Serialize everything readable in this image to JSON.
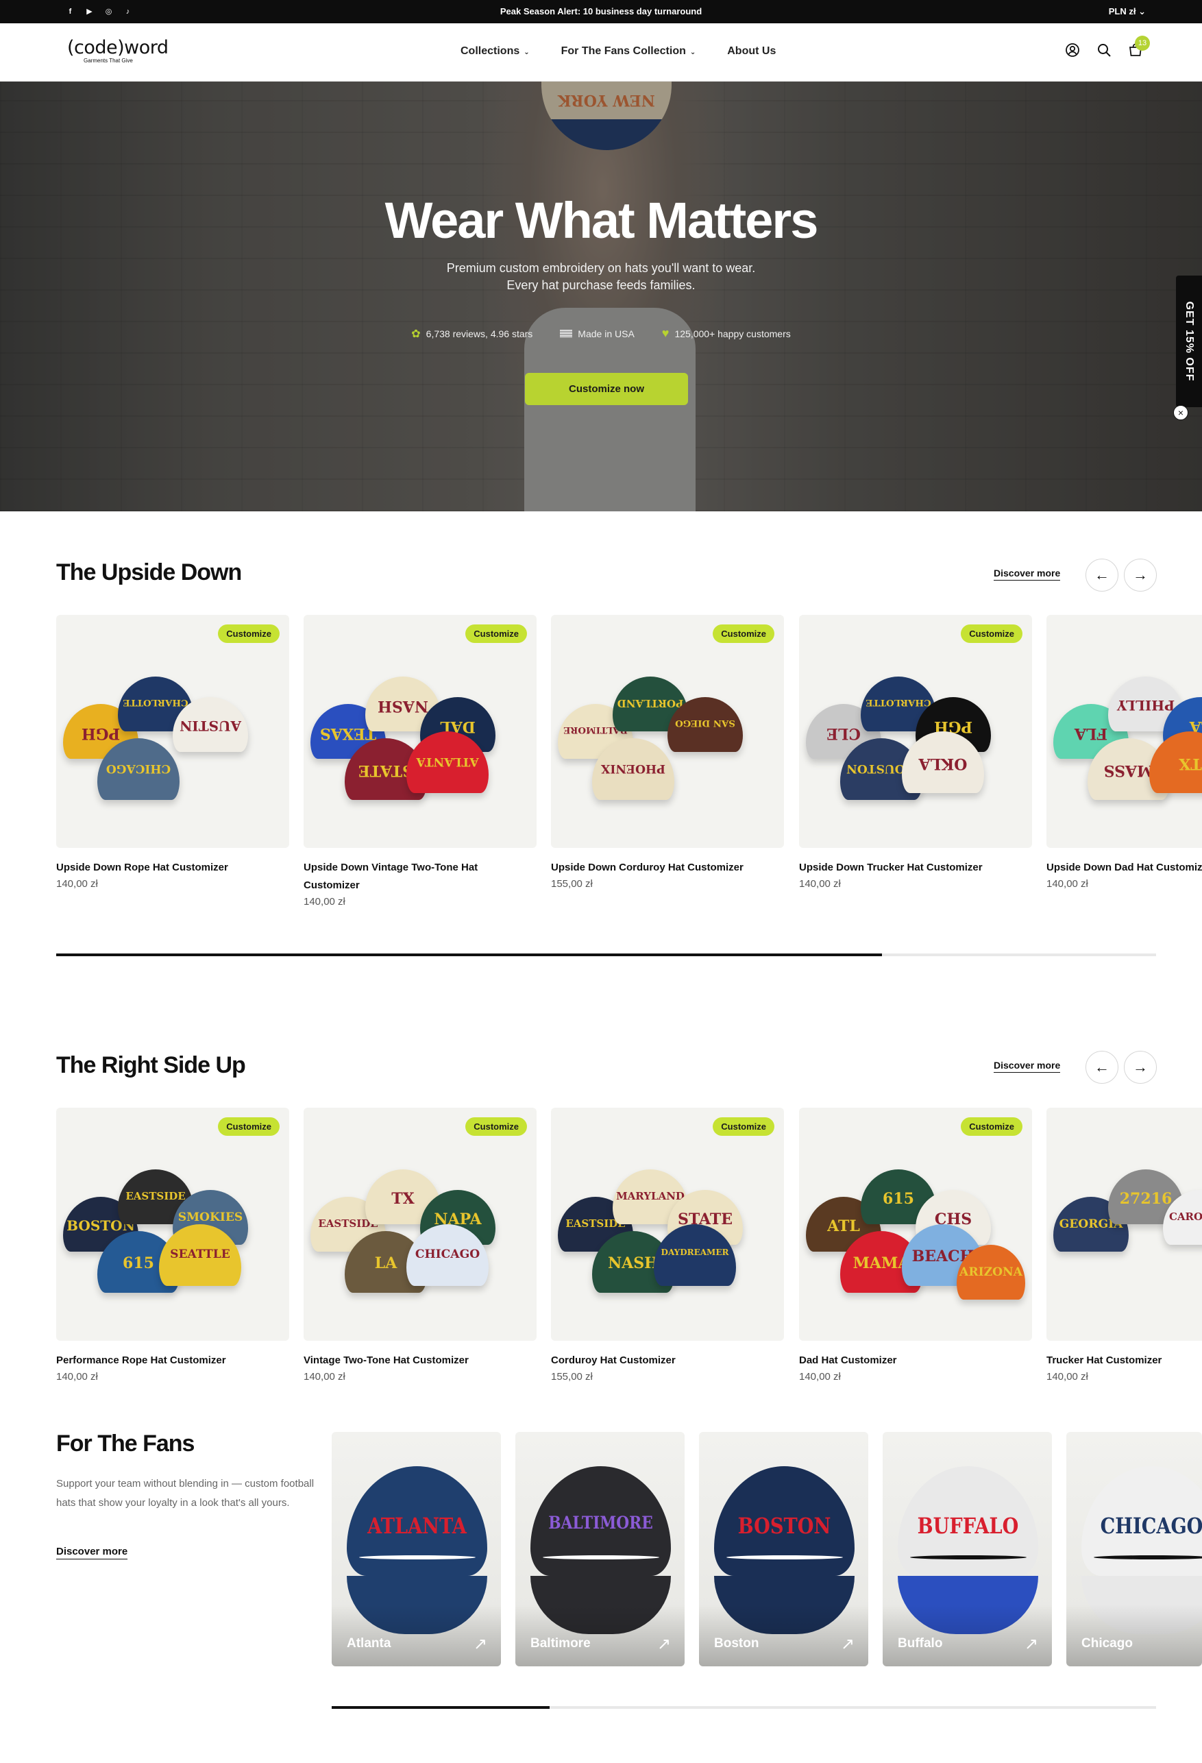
{
  "topbar": {
    "social": [
      "facebook-icon",
      "youtube-icon",
      "instagram-icon",
      "tiktok-icon"
    ],
    "alert": "Peak Season Alert: 10 business day turnaround",
    "currency": "PLN zł ⌄"
  },
  "header": {
    "logo_main": "(code)word",
    "logo_sub": "Garments That Give",
    "nav": [
      {
        "label": "Collections",
        "has_dropdown": true
      },
      {
        "label": "For The Fans Collection",
        "has_dropdown": true
      },
      {
        "label": "About Us",
        "has_dropdown": false
      }
    ],
    "cart_count": "13"
  },
  "hero": {
    "title": "Wear What Matters",
    "subtitle_line1": "Premium custom embroidery on hats you'll want to wear.",
    "subtitle_line2": "Every hat purchase feeds families.",
    "trust": [
      {
        "icon": "stars-icon",
        "text": "6,738 reviews, 4.96 stars"
      },
      {
        "icon": "us-flag-icon",
        "text": "Made in USA"
      },
      {
        "icon": "heart-icon",
        "text": "125,000+ happy customers"
      }
    ],
    "cta": "Customize now",
    "cap_text": "NEW YORK"
  },
  "popup_tab": "GET 15% OFF",
  "sections": [
    {
      "title": "The Upside Down",
      "discover": "Discover more",
      "products": [
        {
          "name": "Upside Down Rope Hat Customizer",
          "price": "140,00 zł",
          "badge": "Customize",
          "hats": [
            [
              "PGH",
              "#e8b020"
            ],
            [
              "CHARLOTTE",
              "#1f3866"
            ],
            [
              "AUSTIN",
              "#f0ede5"
            ],
            [
              "CHICAGO",
              "#4f6b8a"
            ]
          ]
        },
        {
          "name": "Upside Down Vintage Two-Tone Hat Customizer",
          "price": "140,00 zł",
          "badge": "Customize",
          "hats": [
            [
              "TEXAS",
              "#2a4fbf"
            ],
            [
              "NASH",
              "#ede3c4"
            ],
            [
              "DAL",
              "#182b4e"
            ],
            [
              "STATE",
              "#8b2030"
            ],
            [
              "ATLANTA",
              "#d81f2e"
            ]
          ]
        },
        {
          "name": "Upside Down Corduroy Hat Customizer",
          "price": "155,00 zł",
          "badge": "Customize",
          "hats": [
            [
              "BALTIMORE",
              "#ede3c4"
            ],
            [
              "PORTLAND",
              "#24503d"
            ],
            [
              "SAN DIEGO",
              "#5a3024"
            ],
            [
              "PHOENIX",
              "#e9dec0"
            ]
          ]
        },
        {
          "name": "Upside Down Trucker Hat Customizer",
          "price": "140,00 zł",
          "badge": "Customize",
          "hats": [
            [
              "CLE",
              "#c8c8c8"
            ],
            [
              "CHARLOTTE",
              "#1f3866"
            ],
            [
              "PGH",
              "#111111"
            ],
            [
              "HOUSTON",
              "#2b3d63"
            ],
            [
              "OKLA",
              "#efeadf"
            ]
          ]
        },
        {
          "name": "Upside Down Dad Hat Customizer",
          "price": "140,00 zł",
          "badge": "",
          "hats": [
            [
              "FLA",
              "#5fd4b0"
            ],
            [
              "PHILLY",
              "#e6e6e6"
            ],
            [
              "LA",
              "#2459b0"
            ],
            [
              "MASS",
              "#ece4cf"
            ],
            [
              "TX",
              "#e46a22"
            ]
          ]
        }
      ]
    },
    {
      "title": "The Right Side Up",
      "discover": "Discover more",
      "products": [
        {
          "name": "Performance Rope Hat Customizer",
          "price": "140,00 zł",
          "badge": "Customize",
          "hats": [
            [
              "BOSTON",
              "#1f2a44"
            ],
            [
              "EASTSIDE",
              "#2c2c2c"
            ],
            [
              "SMOKIES",
              "#4c6b8a"
            ],
            [
              "615",
              "#255a94"
            ],
            [
              "SEATTLE",
              "#e8c52d"
            ]
          ]
        },
        {
          "name": "Vintage Two-Tone Hat Customizer",
          "price": "140,00 zł",
          "badge": "Customize",
          "hats": [
            [
              "EASTSIDE",
              "#ede3c4"
            ],
            [
              "TX",
              "#ede3c4"
            ],
            [
              "NAPA",
              "#24503d"
            ],
            [
              "LA",
              "#6b5a3e"
            ],
            [
              "CHICAGO",
              "#dfe7f2"
            ]
          ]
        },
        {
          "name": "Corduroy Hat Customizer",
          "price": "155,00 zł",
          "badge": "Customize",
          "hats": [
            [
              "EASTSIDE",
              "#1f2a44"
            ],
            [
              "MARYLAND",
              "#ede3c4"
            ],
            [
              "STATE",
              "#ede3c4"
            ],
            [
              "NASH",
              "#24503d"
            ],
            [
              "DAYDREAMER",
              "#1f3866"
            ]
          ]
        },
        {
          "name": "Dad Hat Customizer",
          "price": "140,00 zł",
          "badge": "Customize",
          "hats": [
            [
              "ATL",
              "#5a3a22"
            ],
            [
              "615",
              "#24503d"
            ],
            [
              "CHS",
              "#f0ede5"
            ],
            [
              "MAMA",
              "#d81f2e"
            ],
            [
              "BEACH",
              "#7fb0e0"
            ],
            [
              "ARIZONA",
              "#e46a22"
            ]
          ]
        },
        {
          "name": "Trucker Hat Customizer",
          "price": "140,00 zł",
          "badge": "",
          "hats": [
            [
              "GEORGIA",
              "#2b3d63"
            ],
            [
              "27216",
              "#8a8a8a"
            ],
            [
              "CAROLINA",
              "#f0f0f0"
            ]
          ]
        }
      ]
    }
  ],
  "fans": {
    "title": "For The Fans",
    "description": "Support your team without blending in — custom football hats that show your loyalty in a look that's all yours.",
    "discover": "Discover more",
    "teams": [
      {
        "label": "Atlanta",
        "cap_text": "ATLANTA",
        "cap_color": "#1f3f6e",
        "front_color": "#1f3f6e",
        "text_color": "#d81f2e"
      },
      {
        "label": "Baltimore",
        "cap_text": "BALTIMORE",
        "cap_color": "#2a2a2e",
        "front_color": "#2a2a2e",
        "text_color": "#8b5bd6"
      },
      {
        "label": "Boston",
        "cap_text": "BOSTON",
        "cap_color": "#1a2f55",
        "front_color": "#1a2f55",
        "text_color": "#d81f2e"
      },
      {
        "label": "Buffalo",
        "cap_text": "BUFFALO",
        "cap_color": "#e9e9e9",
        "front_color": "#2b4fbf",
        "text_color": "#d81f2e"
      },
      {
        "label": "Chicago",
        "cap_text": "CHICAGO",
        "cap_color": "#f0f0f0",
        "front_color": "#e8e8e8",
        "text_color": "#1f3866"
      }
    ]
  },
  "colors": {
    "accent": "#b8d330",
    "dark": "#0d0d0d"
  }
}
